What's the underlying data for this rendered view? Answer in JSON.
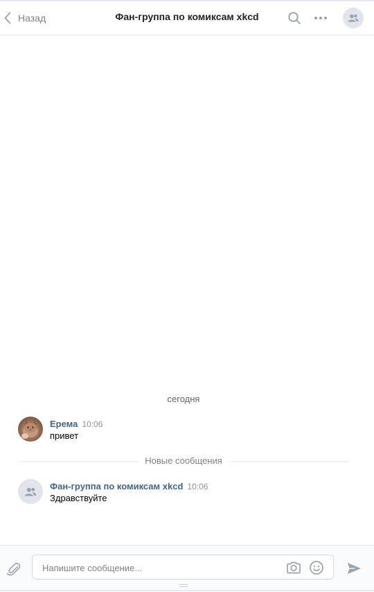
{
  "header": {
    "back_label": "Назад",
    "title": "Фан-группа по комиксам xkcd",
    "icons": [
      "chevron-left-icon",
      "search-icon",
      "more-icon",
      "group-icon"
    ]
  },
  "chat": {
    "date_label": "сегодня",
    "new_messages_label": "Новые сообщения",
    "messages": [
      {
        "author": "Ерема",
        "time": "10:06",
        "text": "привет",
        "avatar": "cat-photo"
      },
      {
        "author": "Фан-группа по комиксам xkcd",
        "time": "10:06",
        "text": "Здравствуйте",
        "avatar": "group-icon"
      }
    ]
  },
  "composer": {
    "placeholder": "Напишите сообщение...",
    "value": "",
    "icons": [
      "paperclip-icon",
      "camera-icon",
      "smile-icon",
      "send-icon"
    ]
  },
  "colors": {
    "link": "#42648b",
    "icon": "#99a2ad",
    "divider": "#e7e8ec"
  }
}
